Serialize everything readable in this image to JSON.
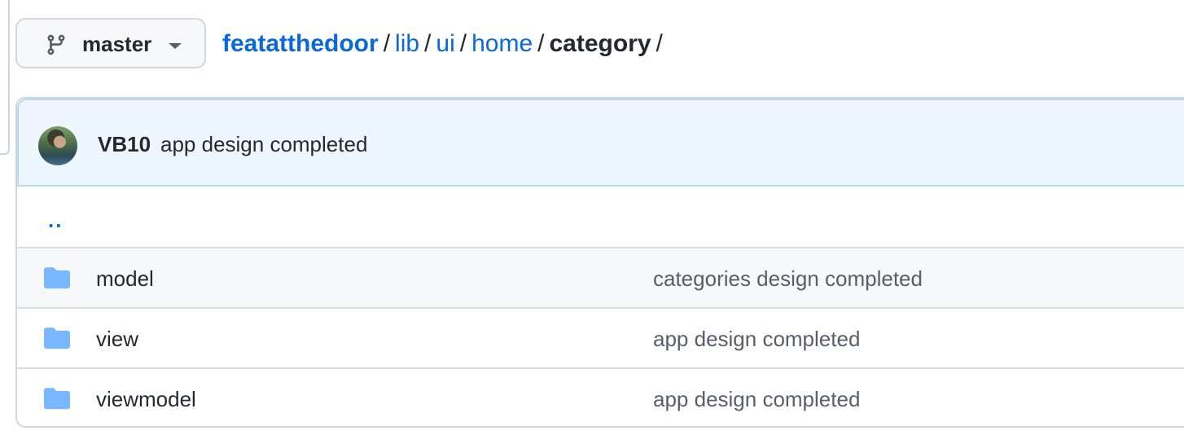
{
  "branch": {
    "label": "master",
    "icon": "git-branch-icon"
  },
  "breadcrumb": {
    "repo": "featatthedoor",
    "segments": [
      "lib",
      "ui",
      "home"
    ],
    "current": "category",
    "separator": "/"
  },
  "latest_commit": {
    "author": "VB10",
    "message": "app design completed"
  },
  "parent_dir": {
    "label": ".."
  },
  "files": [
    {
      "name": "model",
      "type": "folder",
      "commit": "categories design completed"
    },
    {
      "name": "view",
      "type": "folder",
      "commit": "app design completed"
    },
    {
      "name": "viewmodel",
      "type": "folder",
      "commit": "app design completed"
    }
  ],
  "colors": {
    "link": "#0969da",
    "folder": "#54aeff",
    "commit_bar_bg": "#eef6ff",
    "highlight_row_bg": "#f6f8fa"
  }
}
